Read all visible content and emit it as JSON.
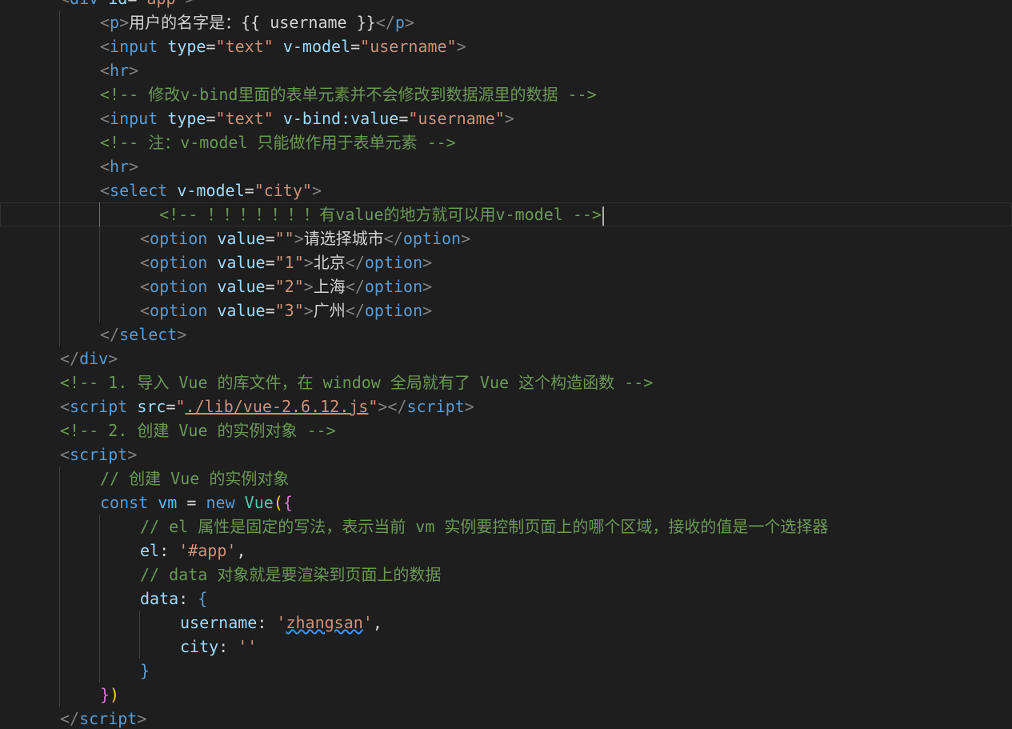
{
  "editor": {
    "lines": [
      {
        "indent": 1,
        "guides": [],
        "tokens": [
          [
            "punc",
            "<"
          ],
          [
            "tag",
            "div"
          ],
          [
            "text",
            " "
          ],
          [
            "attr",
            "id"
          ],
          [
            "text",
            "="
          ],
          [
            "str",
            "\"app\""
          ],
          [
            "punc",
            ">"
          ]
        ]
      },
      {
        "indent": 2,
        "guides": [
          1
        ],
        "tokens": [
          [
            "punc",
            "<"
          ],
          [
            "tag",
            "p"
          ],
          [
            "punc",
            ">"
          ],
          [
            "text",
            "用户的名字是：{{ username }}"
          ],
          [
            "punc",
            "</"
          ],
          [
            "tag",
            "p"
          ],
          [
            "punc",
            ">"
          ]
        ]
      },
      {
        "indent": 2,
        "guides": [
          1
        ],
        "tokens": [
          [
            "punc",
            "<"
          ],
          [
            "tag",
            "input"
          ],
          [
            "text",
            " "
          ],
          [
            "attr",
            "type"
          ],
          [
            "text",
            "="
          ],
          [
            "str",
            "\"text\""
          ],
          [
            "text",
            " "
          ],
          [
            "attr",
            "v-model"
          ],
          [
            "text",
            "="
          ],
          [
            "str",
            "\"username\""
          ],
          [
            "punc",
            ">"
          ]
        ]
      },
      {
        "indent": 2,
        "guides": [
          1
        ],
        "tokens": [
          [
            "punc",
            "<"
          ],
          [
            "tag",
            "hr"
          ],
          [
            "punc",
            ">"
          ]
        ]
      },
      {
        "indent": 2,
        "guides": [
          1
        ],
        "tokens": [
          [
            "comment",
            "<!-- 修改v-bind里面的表单元素并不会修改到数据源里的数据 -->"
          ]
        ]
      },
      {
        "indent": 2,
        "guides": [
          1
        ],
        "tokens": [
          [
            "punc",
            "<"
          ],
          [
            "tag",
            "input"
          ],
          [
            "text",
            " "
          ],
          [
            "attr",
            "type"
          ],
          [
            "text",
            "="
          ],
          [
            "str",
            "\"text\""
          ],
          [
            "text",
            " "
          ],
          [
            "attr",
            "v-bind:value"
          ],
          [
            "text",
            "="
          ],
          [
            "str",
            "\"username\""
          ],
          [
            "punc",
            ">"
          ]
        ]
      },
      {
        "indent": 2,
        "guides": [
          1
        ],
        "tokens": [
          [
            "comment",
            "<!-- 注：v-model 只能做作用于表单元素 -->"
          ]
        ]
      },
      {
        "indent": 2,
        "guides": [
          1
        ],
        "tokens": [
          [
            "punc",
            "<"
          ],
          [
            "tag",
            "hr"
          ],
          [
            "punc",
            ">"
          ]
        ]
      },
      {
        "indent": 2,
        "guides": [
          1
        ],
        "tokens": [
          [
            "punc",
            "<"
          ],
          [
            "tag",
            "select"
          ],
          [
            "text",
            " "
          ],
          [
            "attr",
            "v-model"
          ],
          [
            "text",
            "="
          ],
          [
            "str",
            "\"city\""
          ],
          [
            "punc",
            ">"
          ]
        ]
      },
      {
        "indent": 3,
        "guides": [
          1,
          2
        ],
        "active": true,
        "cursor": true,
        "tokens": [
          [
            "text",
            "  "
          ],
          [
            "comment",
            "<!-- ！！！！！！！有value的地方就可以用v-model -->"
          ]
        ]
      },
      {
        "indent": 3,
        "guides": [
          1,
          2
        ],
        "tokens": [
          [
            "punc",
            "<"
          ],
          [
            "tag",
            "option"
          ],
          [
            "text",
            " "
          ],
          [
            "attr",
            "value"
          ],
          [
            "text",
            "="
          ],
          [
            "str",
            "\"\""
          ],
          [
            "punc",
            ">"
          ],
          [
            "text",
            "请选择城市"
          ],
          [
            "punc",
            "</"
          ],
          [
            "tag",
            "option"
          ],
          [
            "punc",
            ">"
          ]
        ]
      },
      {
        "indent": 3,
        "guides": [
          1,
          2
        ],
        "tokens": [
          [
            "punc",
            "<"
          ],
          [
            "tag",
            "option"
          ],
          [
            "text",
            " "
          ],
          [
            "attr",
            "value"
          ],
          [
            "text",
            "="
          ],
          [
            "str",
            "\"1\""
          ],
          [
            "punc",
            ">"
          ],
          [
            "text",
            "北京"
          ],
          [
            "punc",
            "</"
          ],
          [
            "tag",
            "option"
          ],
          [
            "punc",
            ">"
          ]
        ]
      },
      {
        "indent": 3,
        "guides": [
          1,
          2
        ],
        "tokens": [
          [
            "punc",
            "<"
          ],
          [
            "tag",
            "option"
          ],
          [
            "text",
            " "
          ],
          [
            "attr",
            "value"
          ],
          [
            "text",
            "="
          ],
          [
            "str",
            "\"2\""
          ],
          [
            "punc",
            ">"
          ],
          [
            "text",
            "上海"
          ],
          [
            "punc",
            "</"
          ],
          [
            "tag",
            "option"
          ],
          [
            "punc",
            ">"
          ]
        ]
      },
      {
        "indent": 3,
        "guides": [
          1,
          2
        ],
        "tokens": [
          [
            "punc",
            "<"
          ],
          [
            "tag",
            "option"
          ],
          [
            "text",
            " "
          ],
          [
            "attr",
            "value"
          ],
          [
            "text",
            "="
          ],
          [
            "str",
            "\"3\""
          ],
          [
            "punc",
            ">"
          ],
          [
            "text",
            "广州"
          ],
          [
            "punc",
            "</"
          ],
          [
            "tag",
            "option"
          ],
          [
            "punc",
            ">"
          ]
        ]
      },
      {
        "indent": 2,
        "guides": [
          1
        ],
        "tokens": [
          [
            "punc",
            "</"
          ],
          [
            "tag",
            "select"
          ],
          [
            "punc",
            ">"
          ]
        ]
      },
      {
        "indent": 1,
        "guides": [],
        "tokens": [
          [
            "punc",
            "</"
          ],
          [
            "tag",
            "div"
          ],
          [
            "punc",
            ">"
          ]
        ]
      },
      {
        "indent": 1,
        "guides": [],
        "tokens": [
          [
            "comment",
            "<!-- 1. 导入 Vue 的库文件，在 window 全局就有了 Vue 这个构造函数 -->"
          ]
        ]
      },
      {
        "indent": 1,
        "guides": [],
        "tokens": [
          [
            "punc",
            "<"
          ],
          [
            "tag",
            "script"
          ],
          [
            "text",
            " "
          ],
          [
            "attr",
            "src"
          ],
          [
            "text",
            "="
          ],
          [
            "str",
            "\""
          ],
          [
            "str-link",
            "./lib/vue-2.6.12.js"
          ],
          [
            "str",
            "\""
          ],
          [
            "punc",
            "></"
          ],
          [
            "tag",
            "script"
          ],
          [
            "punc",
            ">"
          ]
        ]
      },
      {
        "indent": 1,
        "guides": [],
        "tokens": [
          [
            "comment",
            "<!-- 2. 创建 Vue 的实例对象 -->"
          ]
        ]
      },
      {
        "indent": 1,
        "guides": [],
        "tokens": [
          [
            "punc",
            "<"
          ],
          [
            "tag",
            "script"
          ],
          [
            "punc",
            ">"
          ]
        ]
      },
      {
        "indent": 2,
        "guides": [
          1
        ],
        "tokens": [
          [
            "comment",
            "// 创建 Vue 的实例对象"
          ]
        ]
      },
      {
        "indent": 2,
        "guides": [
          1
        ],
        "tokens": [
          [
            "kw",
            "const"
          ],
          [
            "text",
            " "
          ],
          [
            "var",
            "vm"
          ],
          [
            "text",
            " = "
          ],
          [
            "kw",
            "new"
          ],
          [
            "text",
            " "
          ],
          [
            "fn",
            "Vue"
          ],
          [
            "paren-y",
            "("
          ],
          [
            "paren-p",
            "{"
          ]
        ]
      },
      {
        "indent": 3,
        "guides": [
          1,
          2
        ],
        "tokens": [
          [
            "comment",
            "// el 属性是固定的写法，表示当前 vm 实例要控制页面上的哪个区域，接收的值是一个选择器"
          ]
        ]
      },
      {
        "indent": 3,
        "guides": [
          1,
          2
        ],
        "tokens": [
          [
            "attr",
            "el"
          ],
          [
            "text",
            ": "
          ],
          [
            "str",
            "'#app'"
          ],
          [
            "text",
            ","
          ]
        ]
      },
      {
        "indent": 3,
        "guides": [
          1,
          2
        ],
        "tokens": [
          [
            "comment",
            "// data 对象就是要渲染到页面上的数据"
          ]
        ]
      },
      {
        "indent": 3,
        "guides": [
          1,
          2
        ],
        "tokens": [
          [
            "attr",
            "data"
          ],
          [
            "text",
            ": "
          ],
          [
            "tag",
            "{"
          ]
        ]
      },
      {
        "indent": 4,
        "guides": [
          1,
          2,
          3
        ],
        "tokens": [
          [
            "attr",
            "username"
          ],
          [
            "text",
            ": "
          ],
          [
            "str",
            "'"
          ],
          [
            "str-squiggle",
            "zhangsan"
          ],
          [
            "str",
            "'"
          ],
          [
            "text",
            ","
          ]
        ]
      },
      {
        "indent": 4,
        "guides": [
          1,
          2,
          3
        ],
        "tokens": [
          [
            "attr",
            "city"
          ],
          [
            "text",
            ": "
          ],
          [
            "str",
            "''"
          ]
        ]
      },
      {
        "indent": 3,
        "guides": [
          1,
          2
        ],
        "tokens": [
          [
            "tag",
            "}"
          ]
        ]
      },
      {
        "indent": 2,
        "guides": [
          1
        ],
        "tokens": [
          [
            "paren-p",
            "}"
          ],
          [
            "paren-y",
            ")"
          ]
        ]
      },
      {
        "indent": 1,
        "guides": [],
        "tokens": [
          [
            "punc",
            "</"
          ],
          [
            "tag",
            "script"
          ],
          [
            "punc",
            ">"
          ]
        ]
      }
    ]
  }
}
